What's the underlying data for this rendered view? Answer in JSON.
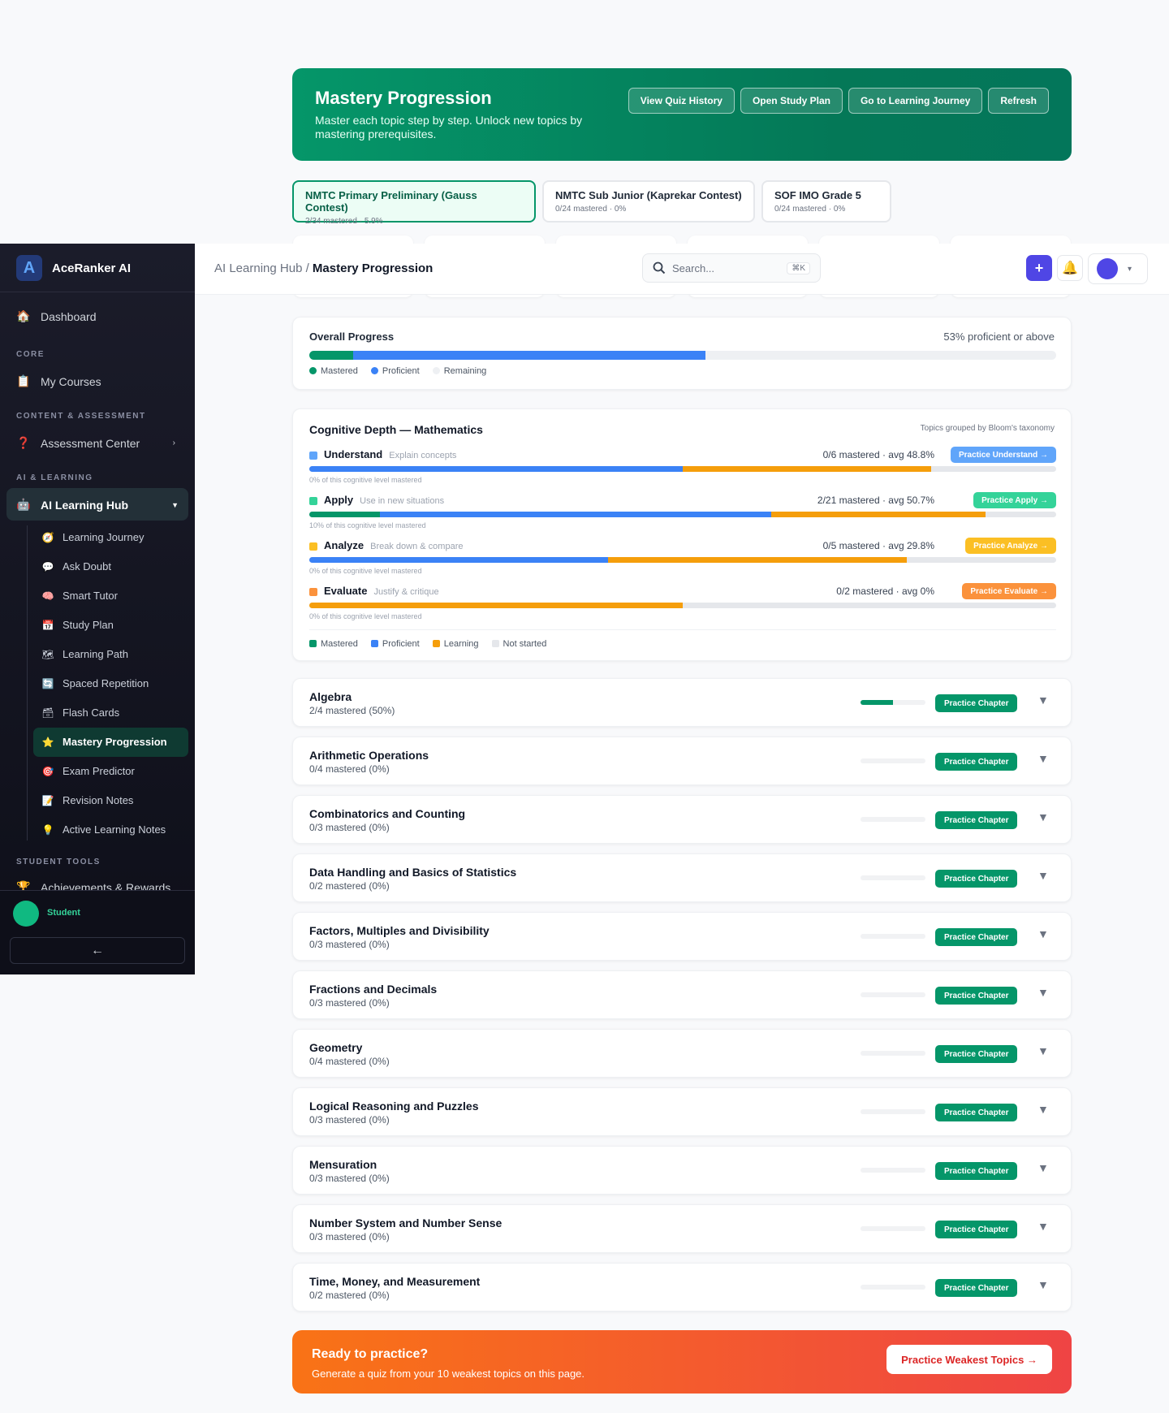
{
  "hero": {
    "title": "Mastery Progression",
    "subtitle": "Master each topic step by step. Unlock new topics by mastering prerequisites.",
    "buttons": [
      "View Quiz History",
      "Open Study Plan",
      "Go to Learning Journey",
      "Refresh"
    ]
  },
  "contests": [
    {
      "name": "NMTC Primary Preliminary (Gauss Contest)",
      "stats": "2/34 mastered · 5.9%",
      "active": true
    },
    {
      "name": "NMTC Sub Junior (Kaprekar Contest)",
      "stats": "0/24 mastered · 0%",
      "active": false
    },
    {
      "name": "SOF IMO Grade 5",
      "stats": "0/24 mastered · 0%",
      "active": false
    }
  ],
  "topbar": {
    "breadcrumb_parent": "AI Learning Hub",
    "breadcrumb_sep": "/",
    "breadcrumb_current": "Mastery Progression",
    "search_placeholder": "Search...",
    "search_shortcut": "⌘K",
    "add_label": "+",
    "user_caret": "▾"
  },
  "sidebar": {
    "app_name": "AceRanker AI",
    "logo_glyph": "A",
    "dashboard": "Dashboard",
    "section_core": "CORE",
    "my_courses": "My Courses",
    "section_content": "CONTENT & ASSESSMENT",
    "assessment_center": "Assessment Center",
    "section_ai": "AI & LEARNING",
    "ai_hub": "AI Learning Hub",
    "sub_items": [
      {
        "label": "Learning Journey",
        "icon": "🧭"
      },
      {
        "label": "Ask Doubt",
        "icon": "💬"
      },
      {
        "label": "Smart Tutor",
        "icon": "🧠"
      },
      {
        "label": "Study Plan",
        "icon": "📅"
      },
      {
        "label": "Learning Path",
        "icon": "🗺"
      },
      {
        "label": "Spaced Repetition",
        "icon": "🔄"
      },
      {
        "label": "Flash Cards",
        "icon": "🗃"
      },
      {
        "label": "Mastery Progression",
        "icon": "⭐"
      },
      {
        "label": "Exam Predictor",
        "icon": "🎯"
      },
      {
        "label": "Revision Notes",
        "icon": "📝"
      },
      {
        "label": "Active Learning Notes",
        "icon": "💡"
      }
    ],
    "section_student": "STUDENT TOOLS",
    "achievements": "Achievements & Rewards",
    "user_name": "Student",
    "collapse_icon": "←"
  },
  "overall": {
    "title": "Overall Progress",
    "summary": "53% proficient or above",
    "mastered_pct": 5.9,
    "proficient_pct": 47.1,
    "legend": [
      "Mastered",
      "Proficient",
      "Remaining"
    ]
  },
  "cognitive": {
    "title": "Cognitive Depth — Mathematics",
    "note": "Topics grouped by Bloom's taxonomy",
    "levels": [
      {
        "name": "Understand",
        "desc": "Explain concepts",
        "stats": "0/6 mastered · avg 48.8%",
        "button": "Practice Understand →",
        "caption": "0% of this cognitive level mastered",
        "color": "#60a5fa",
        "segments": [
          0,
          50,
          33.3
        ]
      },
      {
        "name": "Apply",
        "desc": "Use in new situations",
        "stats": "2/21 mastered · avg 50.7%",
        "button": "Practice Apply →",
        "caption": "10% of this cognitive level mastered",
        "color": "#34d399",
        "segments": [
          9.5,
          52.4,
          28.6
        ]
      },
      {
        "name": "Analyze",
        "desc": "Break down & compare",
        "stats": "0/5 mastered · avg 29.8%",
        "button": "Practice Analyze →",
        "caption": "0% of this cognitive level mastered",
        "color": "#fbbf24",
        "segments": [
          0,
          40,
          40
        ]
      },
      {
        "name": "Evaluate",
        "desc": "Justify & critique",
        "stats": "0/2 mastered · avg 0%",
        "button": "Practice Evaluate →",
        "caption": "0% of this cognitive level mastered",
        "color": "#fb923c",
        "segments": [
          0,
          0,
          50
        ]
      }
    ],
    "legend": [
      "Mastered",
      "Proficient",
      "Learning",
      "Not started"
    ]
  },
  "chapters": [
    {
      "name": "Algebra",
      "stats": "2/4 mastered (50%)",
      "progress": 50
    },
    {
      "name": "Arithmetic Operations",
      "stats": "0/4 mastered (0%)",
      "progress": 0
    },
    {
      "name": "Combinatorics and Counting",
      "stats": "0/3 mastered (0%)",
      "progress": 0
    },
    {
      "name": "Data Handling and Basics of Statistics",
      "stats": "0/2 mastered (0%)",
      "progress": 0
    },
    {
      "name": "Factors, Multiples and Divisibility",
      "stats": "0/3 mastered (0%)",
      "progress": 0
    },
    {
      "name": "Fractions and Decimals",
      "stats": "0/3 mastered (0%)",
      "progress": 0
    },
    {
      "name": "Geometry",
      "stats": "0/4 mastered (0%)",
      "progress": 0
    },
    {
      "name": "Logical Reasoning and Puzzles",
      "stats": "0/3 mastered (0%)",
      "progress": 0
    },
    {
      "name": "Mensuration",
      "stats": "0/3 mastered (0%)",
      "progress": 0
    },
    {
      "name": "Number System and Number Sense",
      "stats": "0/3 mastered (0%)",
      "progress": 0
    },
    {
      "name": "Time, Money, and Measurement",
      "stats": "0/2 mastered (0%)",
      "progress": 0
    }
  ],
  "chapter_button": "Practice Chapter",
  "chapter_toggle": "▼",
  "cta": {
    "title": "Ready to practice?",
    "desc": "Generate a quiz from your 10 weakest topics on this page.",
    "button": "Practice Weakest Topics →"
  },
  "colors": {
    "mastered": "#059669",
    "proficient": "#3b82f6",
    "learning": "#f59e0b",
    "not_started": "#e5e7eb",
    "brand": "#059669",
    "accent": "#4f46e5"
  }
}
